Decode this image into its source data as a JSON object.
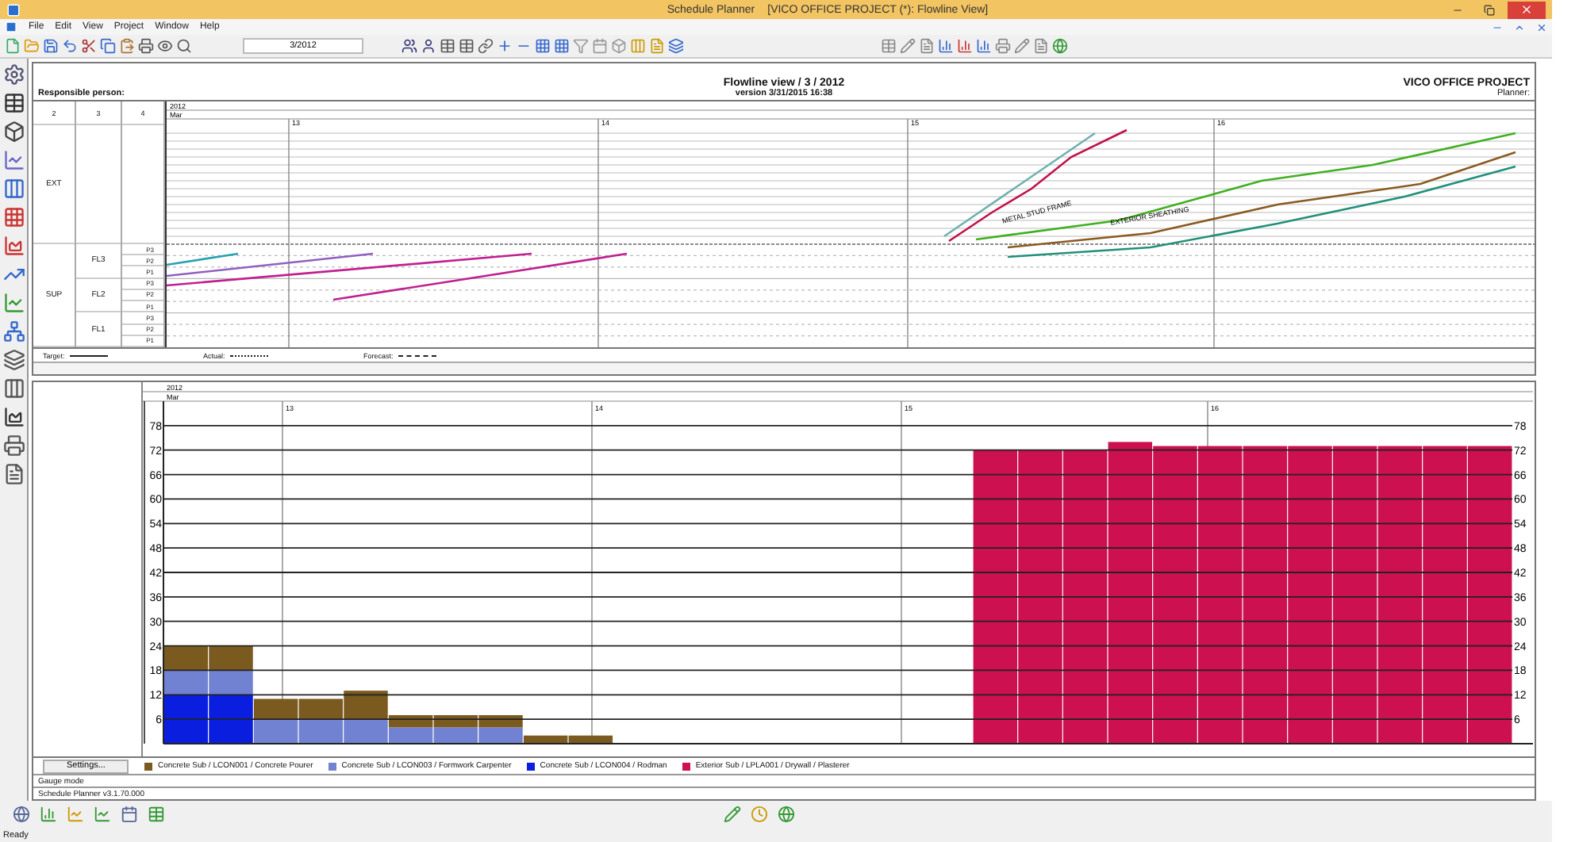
{
  "window": {
    "app_name": "Schedule Planner",
    "document": "[VICO OFFICE PROJECT (*): Flowline View]"
  },
  "menu": [
    "File",
    "Edit",
    "View",
    "Project",
    "Window",
    "Help"
  ],
  "toolbar": {
    "period_field": {
      "value": "3/2012"
    }
  },
  "flowline": {
    "title": "Flowline view / 3 / 2012",
    "version": "version 3/31/2015 16:38",
    "project": "VICO OFFICE PROJECT",
    "planner_label": "Planner:",
    "responsible_label": "Responsible person:",
    "columns": [
      "2",
      "3",
      "4"
    ],
    "year": "2012",
    "month": "Mar",
    "weeks": [
      "13",
      "14",
      "15",
      "16"
    ],
    "locations": [
      {
        "name": "EXT"
      },
      {
        "name": "SUP",
        "floors": [
          {
            "name": "FL3",
            "parts": [
              "P3",
              "P2",
              "P1"
            ]
          },
          {
            "name": "FL2",
            "parts": [
              "P3",
              "P2",
              "P1"
            ]
          },
          {
            "name": "FL1",
            "parts": [
              "P3",
              "P2",
              "P1"
            ]
          }
        ]
      }
    ],
    "line_labels": [
      "METAL STUD FRAME",
      "EXTERIOR SHEATHING"
    ],
    "legend": [
      {
        "label": "Target:",
        "kind": "solid"
      },
      {
        "label": "Actual:",
        "kind": "dotted"
      },
      {
        "label": "Forecast:",
        "kind": "dashed"
      }
    ]
  },
  "histogram": {
    "year": "2012",
    "month": "Mar",
    "weeks": [
      "13",
      "14",
      "15",
      "16"
    ],
    "settings_button": "Settings...",
    "right_axis_labels": [
      "78",
      "72",
      "66",
      "60",
      "54",
      "48",
      "42",
      "36",
      "30",
      "24",
      "18",
      "12",
      "6"
    ],
    "chart_data": {
      "type": "bar",
      "stacked": true,
      "grid": true,
      "categories": [
        null,
        null,
        null,
        null,
        null,
        null,
        null,
        null,
        null,
        null,
        null,
        null,
        null,
        null,
        null,
        null,
        null,
        null,
        null,
        null,
        null,
        null,
        null,
        null,
        null,
        null,
        null,
        null,
        null,
        null
      ],
      "ylim": [
        0,
        84
      ],
      "yticks": [
        6,
        12,
        18,
        24,
        30,
        36,
        42,
        48,
        54,
        60,
        66,
        72,
        78
      ],
      "series": [
        {
          "name": "Concrete Sub / LCON004 / Rodman",
          "color": "#0a1ee0",
          "values": [
            12,
            12,
            null,
            null,
            null,
            null,
            null,
            null,
            null,
            null,
            null,
            null,
            null,
            null,
            null,
            null,
            null,
            null,
            null,
            null,
            null,
            null,
            null,
            null,
            null,
            null,
            null,
            null,
            null,
            null
          ]
        },
        {
          "name": "Concrete Sub / LCON003 / Formwork Carpenter",
          "color": "#7282d2",
          "values": [
            6,
            6,
            6,
            6,
            6,
            4,
            4,
            4,
            null,
            null,
            null,
            null,
            null,
            null,
            null,
            null,
            null,
            null,
            null,
            null,
            null,
            null,
            null,
            null,
            null,
            null,
            null,
            null,
            null,
            null
          ]
        },
        {
          "name": "Concrete Sub / LCON001 / Concrete Pourer",
          "color": "#7a5a1e",
          "values": [
            6,
            6,
            5,
            5,
            7,
            3,
            3,
            3,
            2,
            2,
            null,
            null,
            null,
            null,
            null,
            null,
            null,
            null,
            null,
            null,
            null,
            null,
            null,
            null,
            null,
            null,
            null,
            null,
            null,
            null
          ]
        },
        {
          "name": "Exterior Sub / LPLA001 / Drywall / Plasterer",
          "color": "#cc1050",
          "values": [
            null,
            null,
            null,
            null,
            null,
            null,
            null,
            null,
            null,
            null,
            null,
            null,
            null,
            null,
            null,
            null,
            null,
            null,
            72,
            72,
            72,
            74,
            73,
            73,
            73,
            73,
            73,
            73,
            73,
            73
          ]
        }
      ]
    }
  },
  "status_lines": [
    "Gauge mode",
    "Schedule Planner v3.1.70.000"
  ],
  "status_bar": {
    "text": "Ready"
  }
}
